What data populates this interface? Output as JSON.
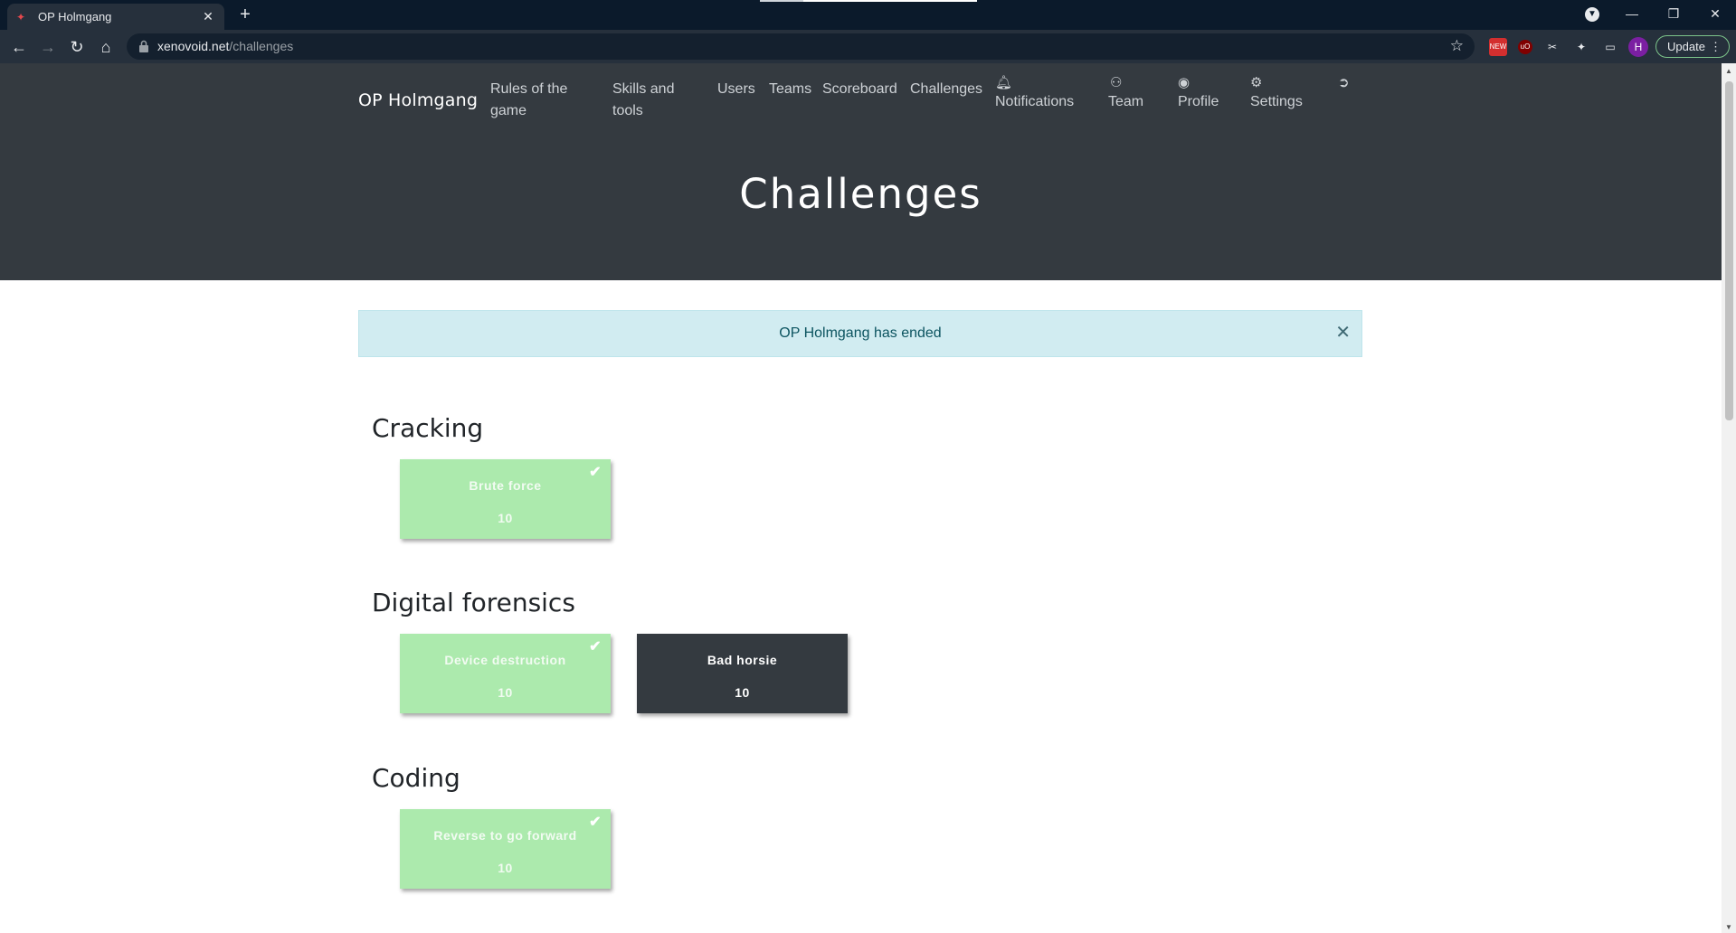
{
  "browser": {
    "tab_title": "OP Holmgang",
    "url_host": "xenovoid.net",
    "url_path": "/challenges",
    "profile_initial": "H",
    "update_label": "Update"
  },
  "nav": {
    "brand": "OP Holmgang",
    "links": [
      {
        "label": "Rules of the game"
      },
      {
        "label": "Skills and tools"
      },
      {
        "label": "Users"
      },
      {
        "label": "Teams"
      },
      {
        "label": "Scoreboard"
      },
      {
        "label": "Challenges"
      }
    ],
    "icon_links": [
      {
        "label": "Notifications",
        "icon": "bell-icon"
      },
      {
        "label": "Team",
        "icon": "users-icon"
      },
      {
        "label": "Profile",
        "icon": "user-circle-icon"
      },
      {
        "label": "Settings",
        "icon": "gears-icon"
      },
      {
        "label": "",
        "icon": "logout-icon"
      }
    ]
  },
  "page_title": "Challenges",
  "alert": {
    "message": "OP Holmgang has ended"
  },
  "categories": [
    {
      "name": "Cracking",
      "challenges": [
        {
          "name": "Brute force",
          "value": "10",
          "solved": true
        }
      ]
    },
    {
      "name": "Digital forensics",
      "challenges": [
        {
          "name": "Device destruction",
          "value": "10",
          "solved": true
        },
        {
          "name": "Bad horsie",
          "value": "10",
          "solved": false
        }
      ]
    },
    {
      "name": "Coding",
      "challenges": [
        {
          "name": "Reverse to go forward",
          "value": "10",
          "solved": true
        }
      ]
    }
  ],
  "colors": {
    "hero_bg": "#343a40",
    "solved_card": "#aceaad",
    "unsolved_card": "#343a40",
    "alert_bg": "#d1ecf1",
    "alert_text": "#0c5460"
  }
}
